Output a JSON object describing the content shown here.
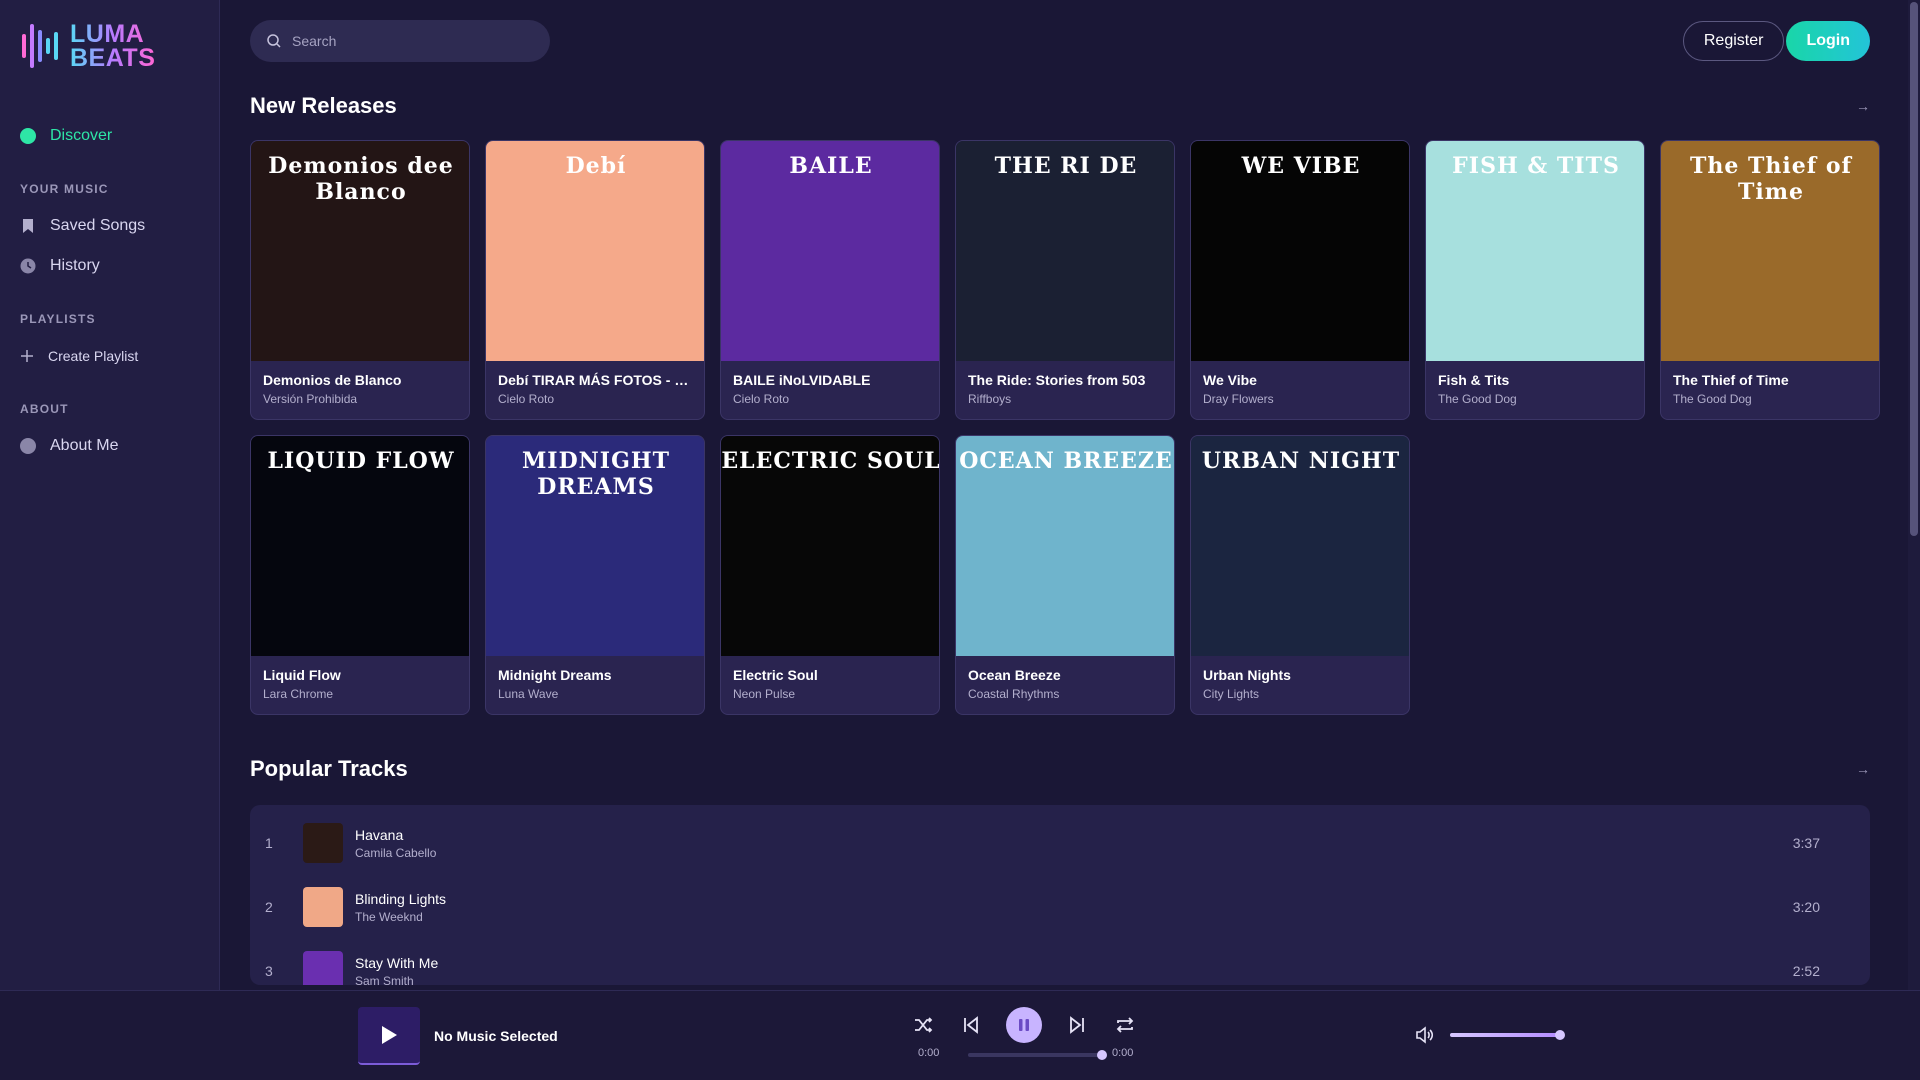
{
  "app": {
    "logo_line1": "LUMA",
    "logo_line2": "BEATS"
  },
  "sidebar": {
    "discover_label": "Discover",
    "your_music_title": "YOUR MUSIC",
    "saved_songs_label": "Saved Songs",
    "history_label": "History",
    "playlists_title": "PLAYLISTS",
    "create_playlist_label": "Create Playlist",
    "about_title": "ABOUT",
    "about_me_label": "About Me"
  },
  "header": {
    "search_placeholder": "Search",
    "register_label": "Register",
    "login_label": "Login"
  },
  "new_releases": {
    "title": "New Releases",
    "arrow": "→",
    "albums": [
      {
        "cover_text": "Demonios dee Blanco",
        "title": "Demonios de Blanco",
        "artist": "Versión Prohibida",
        "bg": "#231515"
      },
      {
        "cover_text": "Debí",
        "title": "Debí TIRAR MÁS FOTOS - DI...",
        "artist": "Cielo Roto",
        "bg": "#f5a98a"
      },
      {
        "cover_text": "BAILE",
        "title": "BAILE iNoLVIDABLE",
        "artist": "Cielo Roto",
        "bg": "#5c2aa0"
      },
      {
        "cover_text": "THE RI DE",
        "title": "The Ride: Stories from 503",
        "artist": "Riffboys",
        "bg": "#1b2033"
      },
      {
        "cover_text": "WE VIBE",
        "title": "We Vibe",
        "artist": "Dray Flowers",
        "bg": "#050505"
      },
      {
        "cover_text": "FISH & TITS",
        "title": "Fish & Tits",
        "artist": "The Good Dog",
        "bg": "#a7e0de"
      },
      {
        "cover_text": "The Thief of Time",
        "title": "The Thief of Time",
        "artist": "The Good Dog",
        "bg": "#9a6a2a"
      },
      {
        "cover_text": "LIQUID FLOW",
        "title": "Liquid Flow",
        "artist": "Lara Chrome",
        "bg": "#05060e"
      },
      {
        "cover_text": "MIDNIGHT DREAMS",
        "title": "Midnight Dreams",
        "artist": "Luna Wave",
        "bg": "#2b2a7a"
      },
      {
        "cover_text": "ELECTRIC SOUL",
        "title": "Electric Soul",
        "artist": "Neon Pulse",
        "bg": "#070707"
      },
      {
        "cover_text": "OCEAN BREEZE",
        "title": "Ocean Breeze",
        "artist": "Coastal Rhythms",
        "bg": "#6fb4cc"
      },
      {
        "cover_text": "URBAN NIGHT",
        "title": "Urban Nights",
        "artist": "City Lights",
        "bg": "#1b2540"
      }
    ]
  },
  "popular_tracks": {
    "title": "Popular Tracks",
    "arrow": "→",
    "tracks": [
      {
        "num": "1",
        "title": "Havana",
        "artist": "Camila Cabello",
        "duration": "3:37",
        "thumb": "#2b1a16"
      },
      {
        "num": "2",
        "title": "Blinding Lights",
        "artist": "The Weeknd",
        "duration": "3:20",
        "thumb": "#f0a887"
      },
      {
        "num": "3",
        "title": "Stay With Me",
        "artist": "Sam Smith",
        "duration": "2:52",
        "thumb": "#6a2fb0"
      }
    ]
  },
  "player": {
    "now_playing": "No Music Selected",
    "time_current": "0:00",
    "time_total": "0:00",
    "progress": 1.0,
    "volume": 1.0
  },
  "colors": {
    "accent": "#2ee6a6",
    "login": "#19d6a8",
    "background": "#1a1736"
  }
}
